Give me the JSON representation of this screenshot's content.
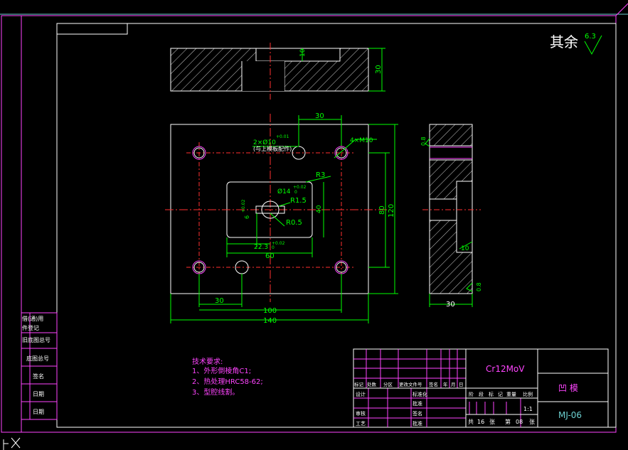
{
  "roughness": {
    "prefix": "其余",
    "value": "6.3"
  },
  "top_view": {
    "depth": "10",
    "height": "30"
  },
  "front_view": {
    "dims": {
      "top_30": "30",
      "holes_small": "2×Ø10",
      "holes_small_tol": "+0.01",
      "holes_small_note": "(与上模板配作)",
      "threads": "4×M10",
      "r3": "R3",
      "hole_dia": "Ø14",
      "hole_dia_tol": "+0.02",
      "hole_dia_tol_low": "0",
      "r15": "R1.5",
      "r05": "R0.5",
      "left_small": "6",
      "left_small_tol": "+0.02",
      "bottom_inner": "22.3",
      "bottom_inner_tol": "+0.02",
      "bottom_inner_tol_low": "0",
      "width_60": "60",
      "height_40": "40",
      "height_80": "80",
      "height_120": "120",
      "left_30": "30",
      "width_100": "100",
      "width_140": "140"
    }
  },
  "side_view": {
    "top_dim": "0.8",
    "mid_dim": "10",
    "bottom_dim": "0.8",
    "width": "30"
  },
  "tech": {
    "title": "技术要求:",
    "items": [
      "1、外形倒棱角C1;",
      "2、热处理HRC58-62;",
      "3、型腔线割。"
    ]
  },
  "left_strip": [
    "借(通)用",
    "件登记",
    "旧底图总号",
    "底图总号",
    "签名",
    "日期",
    "日期"
  ],
  "title_block": {
    "material": "Cr12MoV",
    "part_name": "凹 模",
    "drawing_no": "MJ-06",
    "rev_headers": [
      "标记",
      "处数",
      "分区",
      "更改文件号",
      "签名",
      "年",
      "月",
      "日"
    ],
    "roles": [
      "设计",
      "审核",
      "工艺"
    ],
    "roles_mid": [
      "标准化",
      "批准",
      "签名",
      "批准"
    ],
    "stage_headers": [
      "阶",
      "段",
      "标",
      "记",
      "重量",
      "比例"
    ],
    "scale": "1:1",
    "sheets_label_total": "共",
    "sheets_total": "16",
    "sheets_label_unit": "张",
    "sheets_label_no": "第",
    "sheets_no": "08",
    "sheets_label_unit2": "张"
  }
}
